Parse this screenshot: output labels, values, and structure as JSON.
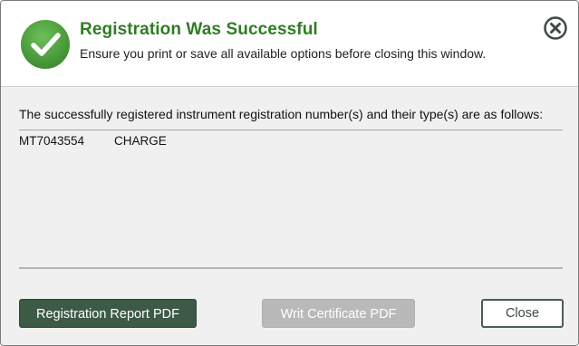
{
  "dialog": {
    "title": "Registration Was Successful",
    "subtitle": "Ensure you print or save all available options before closing this window.",
    "icons": {
      "status": "check-circle-icon",
      "close": "close-circle-icon"
    }
  },
  "content": {
    "intro": "The successfully registered instrument registration number(s) and their type(s) are as follows:",
    "registrations": [
      {
        "number": "MT7043554",
        "type": "CHARGE"
      }
    ]
  },
  "buttons": {
    "registration_report": "Registration Report PDF",
    "writ_certificate": "Writ Certificate PDF",
    "close": "Close"
  },
  "colors": {
    "title_green": "#2e7d22",
    "primary_button": "#3d5a46",
    "disabled_button": "#b9b9b9",
    "success_icon": "#4a9a3a"
  }
}
